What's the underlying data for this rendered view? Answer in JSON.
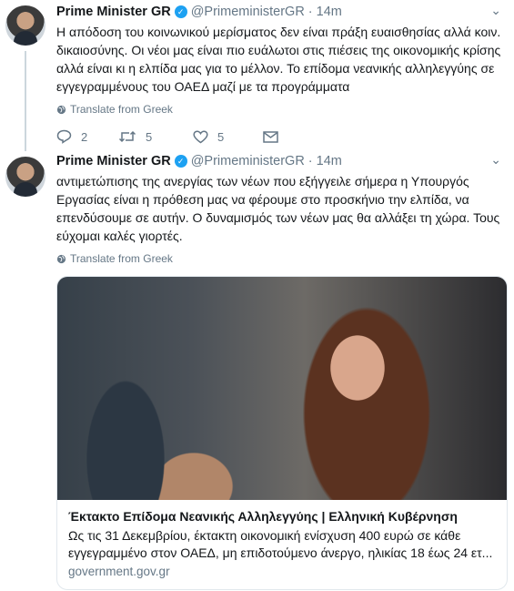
{
  "tweets": [
    {
      "name": "Prime Minister GR",
      "handle": "@PrimeministerGR",
      "separator": "·",
      "time": "14m",
      "lines": [
        "Η απόδοση του κοινωνικού μερίσματος δεν είναι πράξη ευαισθησίας αλλά κοιν.",
        "δικαιοσύνης. Οι νέοι μας είναι πιο ευάλωτοι στις πιέσεις της οικονομικής κρίσης",
        "αλλά είναι κι η ελπίδα μας για το μέλλον. Το επίδομα νεανικής αλληλεγγύης σε",
        "εγγεγραμμένους του ΟΑΕΔ μαζί με τα προγράμματα"
      ],
      "translate": "Translate from Greek",
      "replies": "2",
      "retweets": "5",
      "likes": "5"
    },
    {
      "name": "Prime Minister GR",
      "handle": "@PrimeministerGR",
      "separator": "·",
      "time": "14m",
      "lines": [
        "αντιμετώπισης της ανεργίας των νέων που εξήγγειλε σήμερα η Υπουργός",
        "Εργασίας είναι η πρόθεση μας να φέρουμε στο προσκήνιο την ελπίδα, να",
        "επενδύσουμε σε αυτήν. Ο δυναμισμός των νέων μας θα αλλάξει τη χώρα. Τους",
        "εύχομαι καλές γιορτές."
      ],
      "translate": "Translate from Greek",
      "card": {
        "title": "Έκτακτο Επίδομα Νεανικής Αλληλεγγύης | Ελληνική Κυβέρνηση",
        "desc_line1": "Ως τις 31 Δεκεμβρίου, έκτακτη οικονομική ενίσχυση 400 ευρώ σε κάθε",
        "desc_line2": "εγγεγραμμένο στον ΟΑΕΔ, μη επιδοτούμενο άνεργο, ηλικίας 18 έως 24 ετ...",
        "domain": "government.gov.gr"
      }
    }
  ],
  "icons": {
    "verified": "verified-badge-icon",
    "caret": "chevron-down-icon",
    "globe": "globe-icon",
    "reply": "reply-icon",
    "retweet": "retweet-icon",
    "like": "heart-icon",
    "message": "envelope-icon"
  },
  "colors": {
    "accent": "#1da1f2",
    "muted": "#657786",
    "thread_line": "#ccd6dd"
  }
}
